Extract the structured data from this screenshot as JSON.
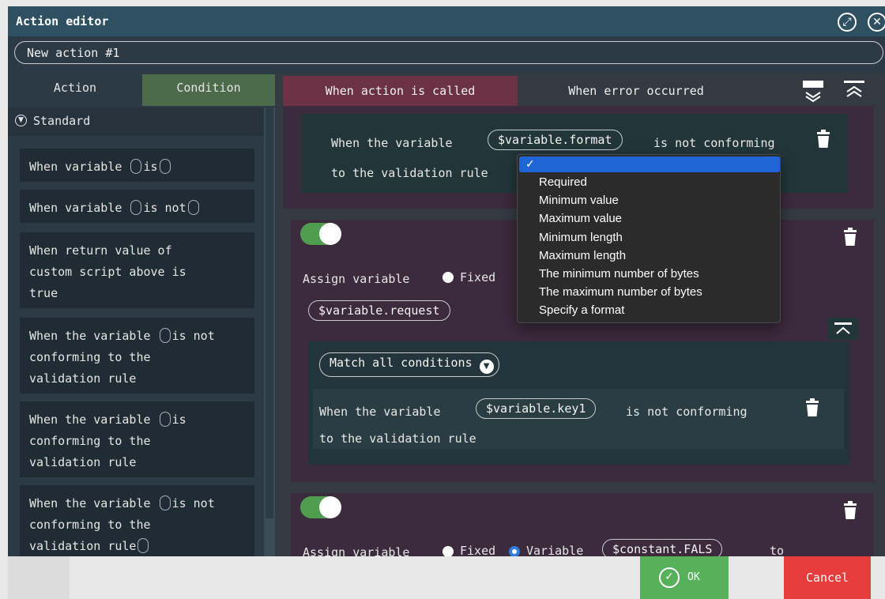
{
  "window": {
    "title": "Action editor"
  },
  "action_name": {
    "value": "New action #1"
  },
  "left_tabs": [
    {
      "label": "Action"
    },
    {
      "label": "Condition"
    }
  ],
  "standard_section": {
    "label": "Standard"
  },
  "condition_items": [
    {
      "lines": [
        "When variable {slot}is{slot}"
      ]
    },
    {
      "lines": [
        "When variable {slot}is not{slot}"
      ]
    },
    {
      "lines": [
        "When return value of",
        "custom script above is",
        "true"
      ]
    },
    {
      "lines": [
        "When the variable {slot}is not",
        "conforming to the",
        "validation rule"
      ]
    },
    {
      "lines": [
        "When the variable {slot}is",
        "conforming to the",
        "validation rule"
      ]
    },
    {
      "lines": [
        "When the variable {slot}is not",
        "conforming to the",
        "validation rule{slot}"
      ]
    }
  ],
  "right_tabs": [
    {
      "label": "When action is called"
    },
    {
      "label": "When error occurred"
    }
  ],
  "block1": {
    "line1_prefix": "When the variable",
    "variable_pill": "$variable.format",
    "line1_suffix": "is not conforming",
    "line2": "to the validation rule"
  },
  "block2": {
    "assign_label": "Assign variable",
    "fixed_label": "Fixed",
    "variable_pill": "$variable.request",
    "match_label": "Match all conditions",
    "cond_prefix": "When the variable",
    "cond_pill": "$variable.key1",
    "cond_suffix": "is not conforming",
    "cond_line2": "to the validation rule"
  },
  "block3": {
    "assign_label": "Assign variable",
    "fixed_label": "Fixed",
    "variable_label": "Variable",
    "constant_pill": "$constant.FALS",
    "to_label": "to"
  },
  "dropdown": {
    "selected_mark": "✓",
    "options": [
      "Required",
      "Minimum value",
      "Maximum value",
      "Minimum length",
      "Maximum length",
      "The minimum number of bytes",
      "The maximum number of bytes",
      "Specify a format"
    ]
  },
  "footer": {
    "ok_label": "OK",
    "cancel_label": "Cancel"
  },
  "colors": {
    "titlebar": "#2f5060",
    "condition_tab": "#4c6b4b",
    "called_tab": "#6b3246",
    "ok": "#57b15a",
    "cancel": "#e63c3c",
    "selection": "#1f65d8"
  },
  "icons": [
    "expand-icon",
    "close-icon",
    "chevron-circle-down-icon",
    "collapse-all-icon",
    "expand-all-icon",
    "trash-icon",
    "check-circle-icon",
    "chevron-up-icon",
    "caret-down-icon"
  ]
}
